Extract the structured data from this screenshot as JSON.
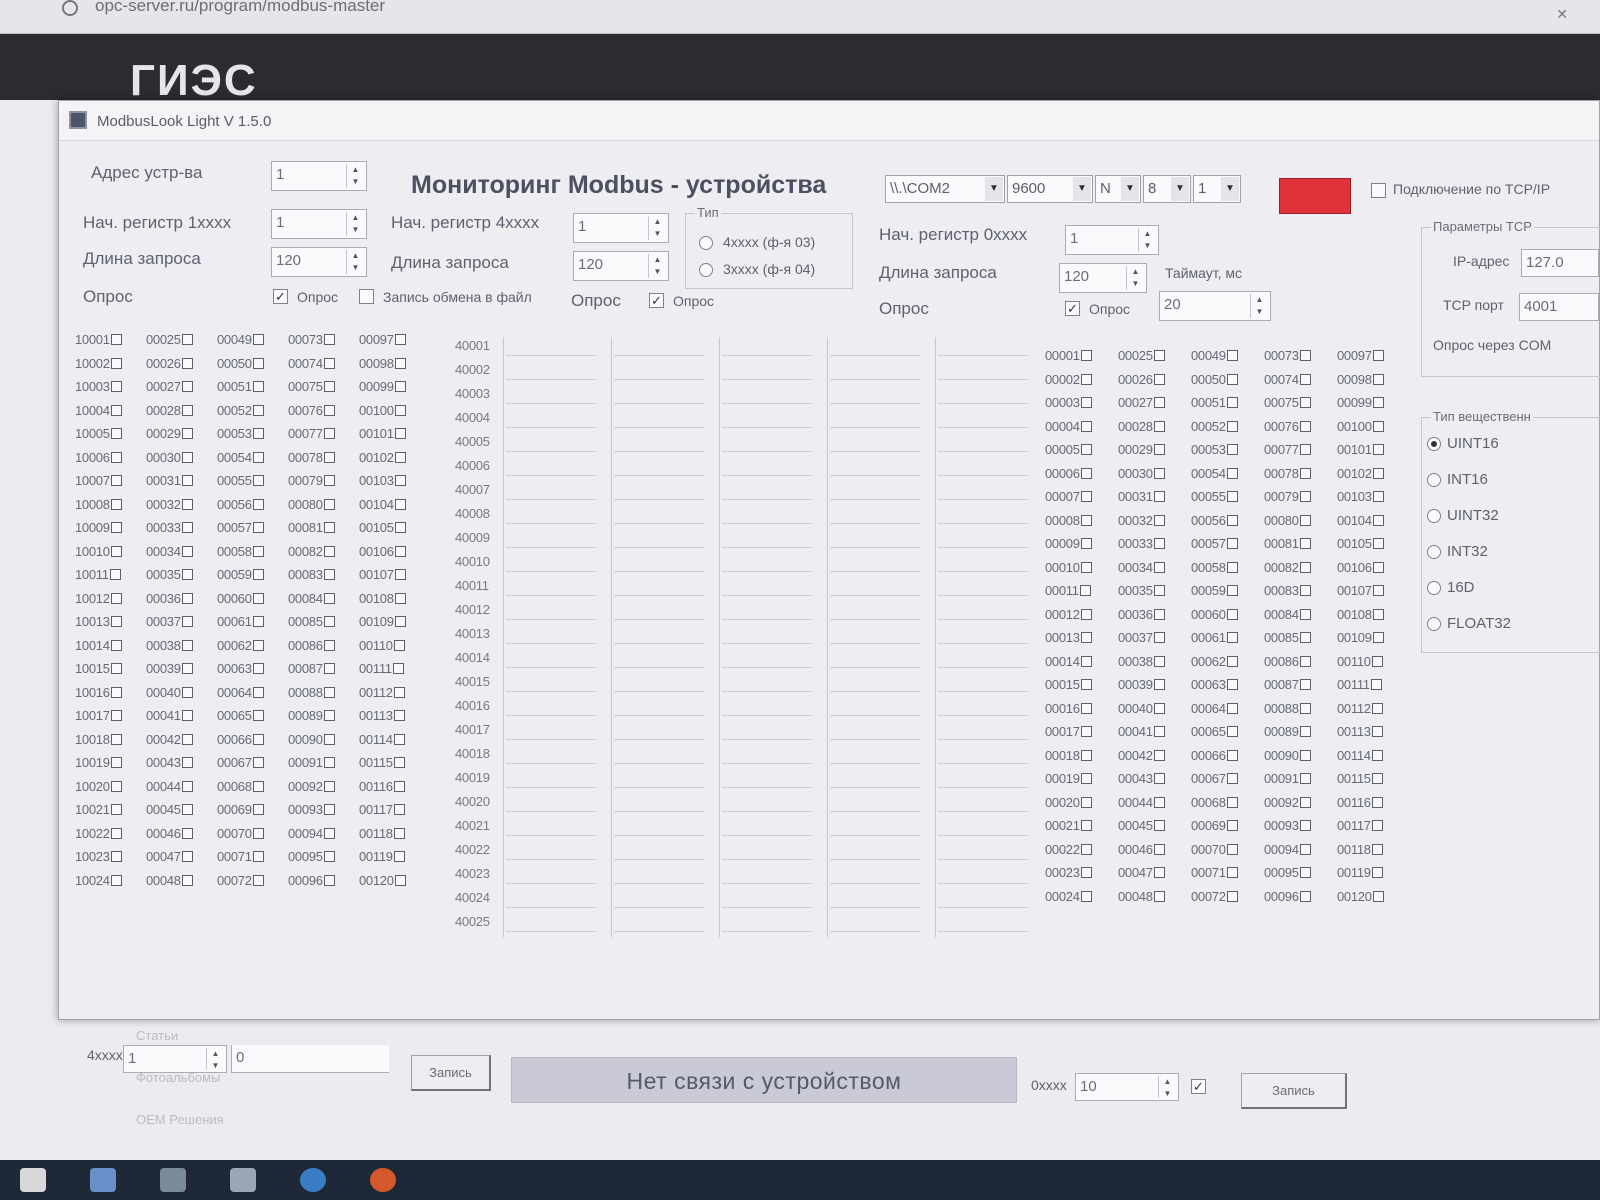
{
  "browser": {
    "url": "opc-server.ru/program/modbus-master"
  },
  "page": {
    "logo": "ГИ​ЭС",
    "links": [
      "Статьи",
      "Фотоальбомы",
      "OEM Решения"
    ]
  },
  "window": {
    "title": "ModbusLook Light V 1.5.0"
  },
  "header": {
    "device_addr_label": "Адрес устр-ва",
    "device_addr_value": "1",
    "main_title": "Мониторинг Modbus - устройства",
    "port": "\\\\.\\COM2",
    "baud": "9600",
    "parity": "N",
    "databits": "8",
    "stopbits": "1",
    "tcp_connect_label": "Подключение по TCP/IP",
    "indicator_color": "#e0323a"
  },
  "left_panel": {
    "start_reg_label": "Нач. регистр 1xxxx",
    "start_reg_value": "1",
    "length_label": "Длина запроса",
    "length_value": "120",
    "poll_label": "Опрос",
    "poll_checkbox_label": "Опрос",
    "poll_checked": true,
    "log_checkbox_label": "Запись обмена в файл",
    "log_checked": false
  },
  "mid_panel": {
    "start_reg_label": "Нач. регистр 4xxxx",
    "start_reg_value": "1",
    "length_label": "Длина запроса",
    "length_value": "120",
    "poll_label": "Опрос",
    "poll_checkbox_label": "Опрос",
    "poll_checked": true,
    "type_group_label": "Тип",
    "type_options": [
      "4xxxx (ф-я 03)",
      "3xxxx (ф-я 04)"
    ]
  },
  "right_panel": {
    "start_reg_label": "Нач. регистр 0xxxx",
    "start_reg_value": "1",
    "length_label": "Длина запроса",
    "length_value": "120",
    "timeout_label": "Таймаут, мс",
    "timeout_value": "20",
    "poll_label": "Опрос",
    "poll_checkbox_label": "Опрос",
    "poll_checked": true
  },
  "tcp_panel": {
    "group_label": "Параметры TCP",
    "ip_label": "IP-адрес",
    "ip_value": "127.0",
    "port_label": "TCP порт",
    "port_value": "4001",
    "via_com_label": "Опрос через COM"
  },
  "type_panel": {
    "group_label": "Тип вещественн",
    "options": [
      "UINT16",
      "INT16",
      "UINT32",
      "INT32",
      "16D",
      "FLOAT32"
    ],
    "selected": "UINT16"
  },
  "discrete_inputs": {
    "columns": [
      [
        "10001",
        "10002",
        "10003",
        "10004",
        "10005",
        "10006",
        "10007",
        "10008",
        "10009",
        "10010",
        "10011",
        "10012",
        "10013",
        "10014",
        "10015",
        "10016",
        "10017",
        "10018",
        "10019",
        "10020",
        "10021",
        "10022",
        "10023",
        "10024"
      ],
      [
        "00025",
        "00026",
        "00027",
        "00028",
        "00029",
        "00030",
        "00031",
        "00032",
        "00033",
        "00034",
        "00035",
        "00036",
        "00037",
        "00038",
        "00039",
        "00040",
        "00041",
        "00042",
        "00043",
        "00044",
        "00045",
        "00046",
        "00047",
        "00048"
      ],
      [
        "00049",
        "00050",
        "00051",
        "00052",
        "00053",
        "00054",
        "00055",
        "00056",
        "00057",
        "00058",
        "00059",
        "00060",
        "00061",
        "00062",
        "00063",
        "00064",
        "00065",
        "00066",
        "00067",
        "00068",
        "00069",
        "00070",
        "00071",
        "00072"
      ],
      [
        "00073",
        "00074",
        "00075",
        "00076",
        "00077",
        "00078",
        "00079",
        "00080",
        "00081",
        "00082",
        "00083",
        "00084",
        "00085",
        "00086",
        "00087",
        "00088",
        "00089",
        "00090",
        "00091",
        "00092",
        "00093",
        "00094",
        "00095",
        "00096"
      ],
      [
        "00097",
        "00098",
        "00099",
        "00100",
        "00101",
        "00102",
        "00103",
        "00104",
        "00105",
        "00106",
        "00107",
        "00108",
        "00109",
        "00110",
        "00111",
        "00112",
        "00113",
        "00114",
        "00115",
        "00116",
        "00117",
        "00118",
        "00119",
        "00120"
      ]
    ]
  },
  "holding_registers": {
    "labels": [
      "40001",
      "40002",
      "40003",
      "40004",
      "40005",
      "40006",
      "40007",
      "40008",
      "40009",
      "40010",
      "40011",
      "40012",
      "40013",
      "40014",
      "40015",
      "40016",
      "40017",
      "40018",
      "40019",
      "40020",
      "40021",
      "40022",
      "40023",
      "40024",
      "40025"
    ]
  },
  "coils": {
    "columns": [
      [
        "00001",
        "00002",
        "00003",
        "00004",
        "00005",
        "00006",
        "00007",
        "00008",
        "00009",
        "00010",
        "00011",
        "00012",
        "00013",
        "00014",
        "00015",
        "00016",
        "00017",
        "00018",
        "00019",
        "00020",
        "00021",
        "00022",
        "00023",
        "00024"
      ],
      [
        "00025",
        "00026",
        "00027",
        "00028",
        "00029",
        "00030",
        "00031",
        "00032",
        "00033",
        "00034",
        "00035",
        "00036",
        "00037",
        "00038",
        "00039",
        "00040",
        "00041",
        "00042",
        "00043",
        "00044",
        "00045",
        "00046",
        "00047",
        "00048"
      ],
      [
        "00049",
        "00050",
        "00051",
        "00052",
        "00053",
        "00054",
        "00055",
        "00056",
        "00057",
        "00058",
        "00059",
        "00060",
        "00061",
        "00062",
        "00063",
        "00064",
        "00065",
        "00066",
        "00067",
        "00068",
        "00069",
        "00070",
        "00071",
        "00072"
      ],
      [
        "00073",
        "00074",
        "00075",
        "00076",
        "00077",
        "00078",
        "00079",
        "00080",
        "00081",
        "00082",
        "00083",
        "00084",
        "00085",
        "00086",
        "00087",
        "00088",
        "00089",
        "00090",
        "00091",
        "00092",
        "00093",
        "00094",
        "00095",
        "00096"
      ],
      [
        "00097",
        "00098",
        "00099",
        "00100",
        "00101",
        "00102",
        "00103",
        "00104",
        "00105",
        "00106",
        "00107",
        "00108",
        "00109",
        "00110",
        "00111",
        "00112",
        "00113",
        "00114",
        "00115",
        "00116",
        "00117",
        "00118",
        "00119",
        "00120"
      ]
    ]
  },
  "footer": {
    "write4_label": "4xxxx",
    "write4_addr": "1",
    "write4_value": "0",
    "write4_button": "Запись",
    "status_text": "Нет связи с устройством",
    "write0_label": "0xxxx",
    "write0_addr": "10",
    "write0_checked": true,
    "write0_button": "Запись"
  }
}
